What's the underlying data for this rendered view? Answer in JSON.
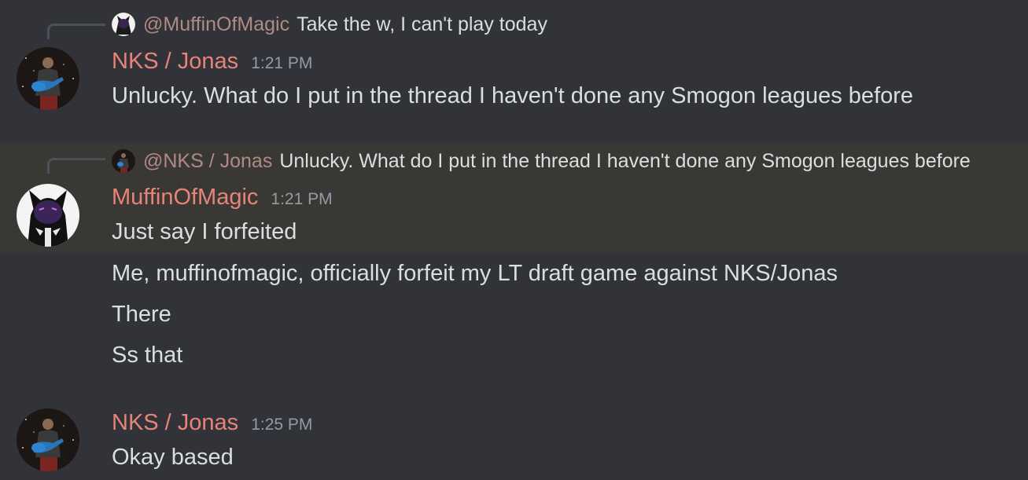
{
  "messages": [
    {
      "reply": {
        "mention": "@MuffinOfMagic",
        "text": "Take the w, I can't play today"
      },
      "author": "NKS / Jonas",
      "time": "1:21 PM",
      "lines": [
        "Unlucky. What do I put in the thread I haven't done any Smogon leagues before"
      ]
    },
    {
      "reply": {
        "mention": "@NKS / Jonas",
        "text": "Unlucky. What do I put in the thread I haven't done any Smogon leagues before"
      },
      "author": "MuffinOfMagic",
      "time": "1:21 PM",
      "lines": [
        "Just say I forfeited",
        "Me, muffinofmagic, officially forfeit my LT draft game against NKS/Jonas",
        "There",
        "Ss that"
      ]
    },
    {
      "author": "NKS / Jonas",
      "time": "1:25 PM",
      "lines": [
        "Okay based"
      ]
    }
  ],
  "colors": {
    "background": "#313338",
    "highlight": "#3a3835",
    "username": "#e8837a",
    "mention": "#b08a85",
    "timestamp": "#949ba4",
    "text": "#dbdee1"
  },
  "icons": {
    "nks_avatar": "guitar-player-avatar",
    "muffin_avatar": "purple-cat-avatar"
  }
}
